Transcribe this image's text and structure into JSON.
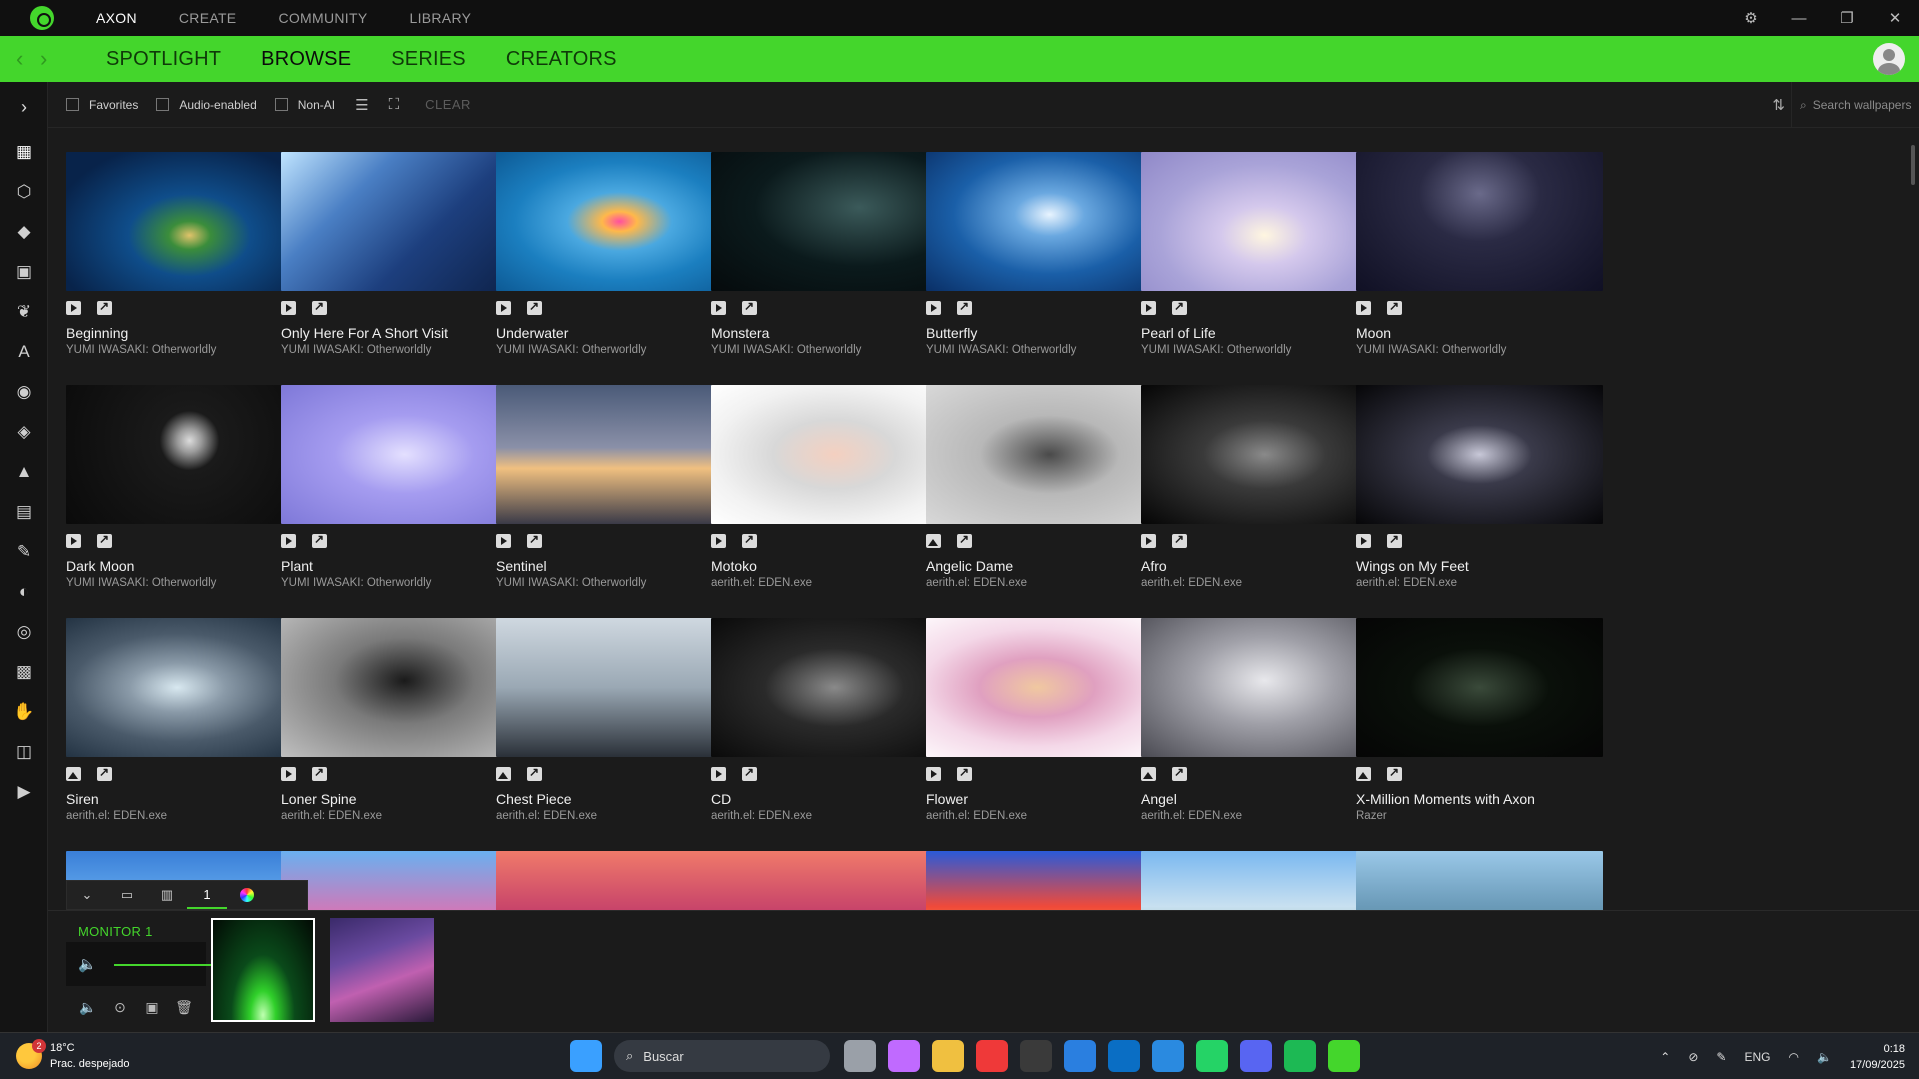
{
  "app": {
    "top_menu": [
      "AXON",
      "CREATE",
      "COMMUNITY",
      "LIBRARY"
    ],
    "active_top_menu": 0,
    "sub_nav": [
      "SPOTLIGHT",
      "BROWSE",
      "SERIES",
      "CREATORS"
    ],
    "active_sub_nav": 1,
    "accent_color": "#44d62c"
  },
  "filters": {
    "favorites_label": "Favorites",
    "audio_label": "Audio-enabled",
    "nonai_label": "Non-AI",
    "clear_label": "CLEAR",
    "search_placeholder": "Search wallpapers"
  },
  "sidebar_icons": [
    "dashboard-icon",
    "cube-icon",
    "gem-icon",
    "puzzle-icon",
    "leaf-icon",
    "text-a-icon",
    "gamepad-icon",
    "tag-icon",
    "mountain-icon",
    "film-icon",
    "document-edit-icon",
    "palette-icon",
    "aperture-icon",
    "grid-dots-icon",
    "hand-icon",
    "chip-icon",
    "clapperboard-icon"
  ],
  "wallpapers": [
    {
      "title": "Beginning",
      "author": "YUMI IWASAKI: Otherworldly",
      "type": "video"
    },
    {
      "title": "Only Here For A Short Visit",
      "author": "YUMI IWASAKI: Otherworldly",
      "type": "video"
    },
    {
      "title": "Underwater",
      "author": "YUMI IWASAKI: Otherworldly",
      "type": "video"
    },
    {
      "title": "Monstera",
      "author": "YUMI IWASAKI: Otherworldly",
      "type": "video"
    },
    {
      "title": "Butterfly",
      "author": "YUMI IWASAKI: Otherworldly",
      "type": "video"
    },
    {
      "title": "Pearl of Life",
      "author": "YUMI IWASAKI: Otherworldly",
      "type": "video"
    },
    {
      "title": "Moon",
      "author": "YUMI IWASAKI: Otherworldly",
      "type": "video"
    },
    {
      "title": "Dark Moon",
      "author": "YUMI IWASAKI: Otherworldly",
      "type": "video"
    },
    {
      "title": "Plant",
      "author": "YUMI IWASAKI: Otherworldly",
      "type": "video"
    },
    {
      "title": "Sentinel",
      "author": "YUMI IWASAKI: Otherworldly",
      "type": "video"
    },
    {
      "title": "Motoko",
      "author": "aerith.el: EDEN.exe",
      "type": "video"
    },
    {
      "title": "Angelic Dame",
      "author": "aerith.el: EDEN.exe",
      "type": "image"
    },
    {
      "title": "Afro",
      "author": "aerith.el: EDEN.exe",
      "type": "video"
    },
    {
      "title": "Wings on My Feet",
      "author": "aerith.el: EDEN.exe",
      "type": "video"
    },
    {
      "title": "Siren",
      "author": "aerith.el: EDEN.exe",
      "type": "image"
    },
    {
      "title": "Loner Spine",
      "author": "aerith.el: EDEN.exe",
      "type": "video"
    },
    {
      "title": "Chest Piece",
      "author": "aerith.el: EDEN.exe",
      "type": "image"
    },
    {
      "title": "CD",
      "author": "aerith.el: EDEN.exe",
      "type": "video"
    },
    {
      "title": "Flower",
      "author": "aerith.el: EDEN.exe",
      "type": "video"
    },
    {
      "title": "Angel",
      "author": "aerith.el: EDEN.exe",
      "type": "image"
    },
    {
      "title": "X-Million Moments with Axon",
      "author": "Razer",
      "type": "image"
    },
    {
      "title": "",
      "author": "",
      "type": "video"
    },
    {
      "title": "",
      "author": "",
      "type": "video"
    },
    {
      "title": "",
      "author": "",
      "type": "video"
    },
    {
      "title": "",
      "author": "",
      "type": "video"
    },
    {
      "title": "",
      "author": "",
      "type": "video"
    },
    {
      "title": "",
      "author": "",
      "type": "video"
    },
    {
      "title": "",
      "author": "",
      "type": "video"
    }
  ],
  "thumb_styles": [
    "radial-gradient(ellipse at 50% 60%,#e0c36a 0%,#3b8d3b 12%,#0f4d8a 35%,#08234a 80%)",
    "linear-gradient(135deg,#bfe4ff 0%,#4a7fc4 30%,#1d3f7e 60%,#0c1f44 100%)",
    "radial-gradient(ellipse at 50% 50%,#ff4fa0 0%,#ffb84a 10%,#4aa8e0 30%,#1b7fc0 60%,#0d5a95 100%)",
    "radial-gradient(ellipse at 60% 40%,#3b5a5a 0%,#0b1a1c 50%,#050a0c 100%)",
    "radial-gradient(ellipse at 50% 45%,#e8f4ff 0%,#6aa8e0 20%,#1a5fa8 55%,#0a2f66 100%)",
    "radial-gradient(ellipse at 50% 60%,#fff6e0 0%,#d4c8ec 25%,#a9a3d8 60%,#8f88c8 100%)",
    "radial-gradient(ellipse at 50% 30%,#6a6a8a 0%,#2a2a44 35%,#101024 100%)",
    "radial-gradient(circle at 50% 40%,#dcdcdc 0%,#9a9a9a 8%,#1a1a1a 20%,#0a0a0a 100%)",
    "radial-gradient(ellipse at 50% 50%,#e4e0ff 0%,#a59cf0 40%,#7e78d8 100%)",
    "linear-gradient(180deg,#4a5a78 0%,#8a90a8 45%,#f0c080 60%,#3a3a48 100%)",
    "radial-gradient(ellipse at 50% 50%,#f4d0c0 0%,#d8d8d8 35%,#f2f2f2 70%,#ffffff 100%)",
    "radial-gradient(ellipse at 50% 50%,#4a4a4a 0%,#b8b8b8 40%,#d8d8d8 100%)",
    "radial-gradient(ellipse at 50% 50%,#8a8a8a 0%,#3a3a3a 35%,#050505 100%)",
    "radial-gradient(ellipse at 50% 50%,#c8c8d8 0%,#3a3a4a 30%,#060608 100%)",
    "radial-gradient(ellipse at 45% 50%,#d8e8f0 0%,#8a9aa8 25%,#4a5a6a 55%,#1a2a3a 100%)",
    "radial-gradient(ellipse at 50% 45%,#1a1a1a 0%,#7a7a7a 40%,#c0c0c0 100%)",
    "linear-gradient(180deg,#cfd8e0 0%,#9aa8b4 50%,#2a3038 100%)",
    "radial-gradient(ellipse at 50% 50%,#8a8a8a 0%,#2a2a2a 40%,#0a0a0a 100%)",
    "radial-gradient(ellipse at 45% 50%,#f0c8a0 0%,#e0a0c0 30%,#f4d8e8 60%,#ffffff 100%)",
    "radial-gradient(ellipse at 50% 45%,#e8e8ec 0%,#a0a0a8 40%,#4a4a52 100%)",
    "radial-gradient(ellipse at 50% 50%,#3a4a3a 0%,#0a100a 40%,#050505 100%)",
    "linear-gradient(180deg,#3a7fd8 0%,#6ab0f0 40%,#c04a8a 75%,#2a2a6a 100%)",
    "linear-gradient(180deg,#6ab0f0 0%,#e070b0 50%,#4a3a8a 100%)",
    "linear-gradient(180deg,#f07a6a 0%,#c03a6a 50%,#3a1a4a 100%)",
    "linear-gradient(180deg,#f07a6a 0%,#c03a6a 50%,#3a1a4a 100%)",
    "linear-gradient(180deg,#2a5ad8 0%,#f04a3a 40%,#ffb040 70%,#f08a3a 100%)",
    "linear-gradient(180deg,#7ab8f0 0%,#c8e0f0 40%,#4a8a3a 100%)",
    "linear-gradient(180deg,#9ac8e8 0%,#6a9ab8 40%,#4a7a5a 100%)"
  ],
  "monitor": {
    "label": "MONITOR 1",
    "number": "1",
    "volume_percent": 100,
    "current_thumb": "radial-gradient(ellipse at 50% 95%,#bfffb0 0%,#30d02a 18%,#0a4a1a 45%,#020a04 100%)",
    "alt_thumb": "linear-gradient(160deg,#3a2a6a 0%,#6a4aa0 35%,#c060b0 60%,#2a1a3a 100%)"
  },
  "taskbar": {
    "weather_temp": "18°C",
    "weather_desc": "Prac. despejado",
    "weather_badge": "2",
    "search_label": "Buscar",
    "lang": "ENG",
    "time": "0:18",
    "date": "17/09/2025",
    "apps": [
      {
        "name": "start-icon",
        "color": "#3aa0ff"
      },
      {
        "name": "task-view-icon",
        "color": "#9aa0a8"
      },
      {
        "name": "copilot-icon",
        "color": "#c06aff"
      },
      {
        "name": "file-explorer-icon",
        "color": "#f0c040"
      },
      {
        "name": "vivaldi-icon",
        "color": "#ef3939"
      },
      {
        "name": "terminal-icon",
        "color": "#3a3a3a"
      },
      {
        "name": "store-icon",
        "color": "#2a7fe0"
      },
      {
        "name": "outlook-icon",
        "color": "#0a6ec4"
      },
      {
        "name": "vscode-icon",
        "color": "#2a8ae0"
      },
      {
        "name": "whatsapp-icon",
        "color": "#25d366"
      },
      {
        "name": "discord-icon",
        "color": "#5865f2"
      },
      {
        "name": "spotify-icon",
        "color": "#1db954"
      },
      {
        "name": "razer-axon-icon",
        "color": "#44d62c"
      }
    ]
  }
}
